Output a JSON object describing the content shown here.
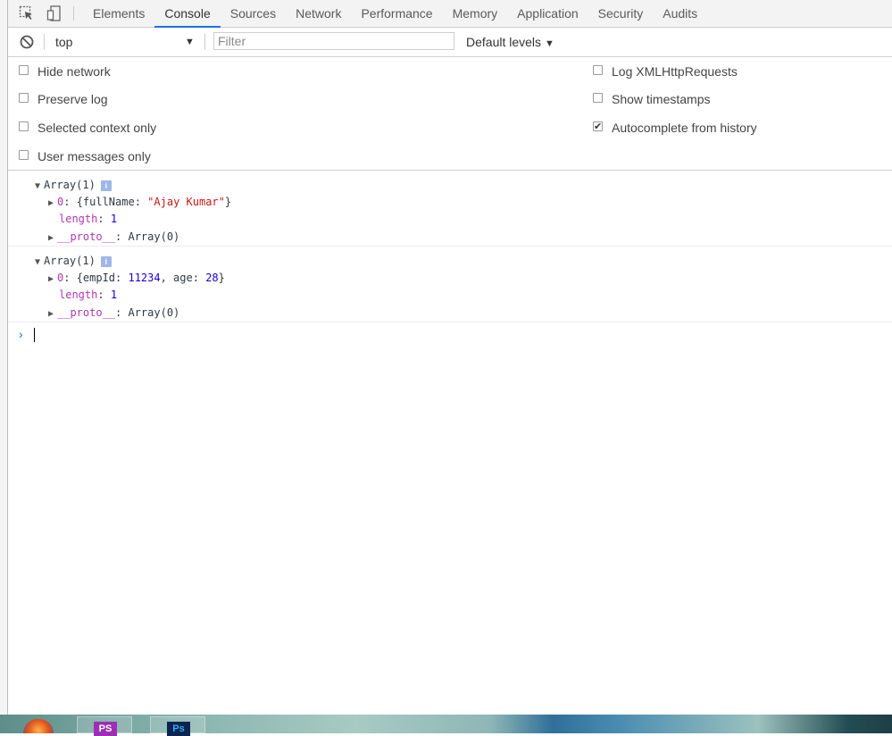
{
  "tabs": [
    {
      "label": "Elements"
    },
    {
      "label": "Console"
    },
    {
      "label": "Sources"
    },
    {
      "label": "Network"
    },
    {
      "label": "Performance"
    },
    {
      "label": "Memory"
    },
    {
      "label": "Application"
    },
    {
      "label": "Security"
    },
    {
      "label": "Audits"
    }
  ],
  "active_tab": "Console",
  "toolbar": {
    "context": "top",
    "filter_placeholder": "Filter",
    "levels": "Default levels"
  },
  "settings": {
    "left": [
      {
        "label": "Hide network",
        "checked": false
      },
      {
        "label": "Preserve log",
        "checked": false
      },
      {
        "label": "Selected context only",
        "checked": false
      },
      {
        "label": "User messages only",
        "checked": false
      }
    ],
    "right": [
      {
        "label": "Log XMLHttpRequests",
        "checked": false
      },
      {
        "label": "Show timestamps",
        "checked": false
      },
      {
        "label": "Autocomplete from history",
        "checked": true
      }
    ]
  },
  "log": [
    {
      "header": "Array(1)",
      "item_key": "0",
      "item_obj": "{fullName: \"Ajay Kumar\"}",
      "item_open": "{fullName: ",
      "item_str": "\"Ajay Kumar\"",
      "item_close": "}",
      "length_key": "length",
      "length_val": "1",
      "proto_key": "__proto__",
      "proto_val": "Array(0)"
    },
    {
      "header": "Array(1)",
      "item_key": "0",
      "item_open": "{empId: ",
      "item_num1": "11234",
      "item_mid": ", age: ",
      "item_num2": "28",
      "item_close": "}",
      "length_key": "length",
      "length_val": "1",
      "proto_key": "__proto__",
      "proto_val": "Array(0)"
    }
  ],
  "taskbar": {
    "apps": [
      "PS",
      "Ps"
    ]
  },
  "icons": {
    "inspect": "inspect-element-icon",
    "device": "device-toolbar-icon",
    "clear": "clear-console-icon",
    "info": "info-icon"
  }
}
